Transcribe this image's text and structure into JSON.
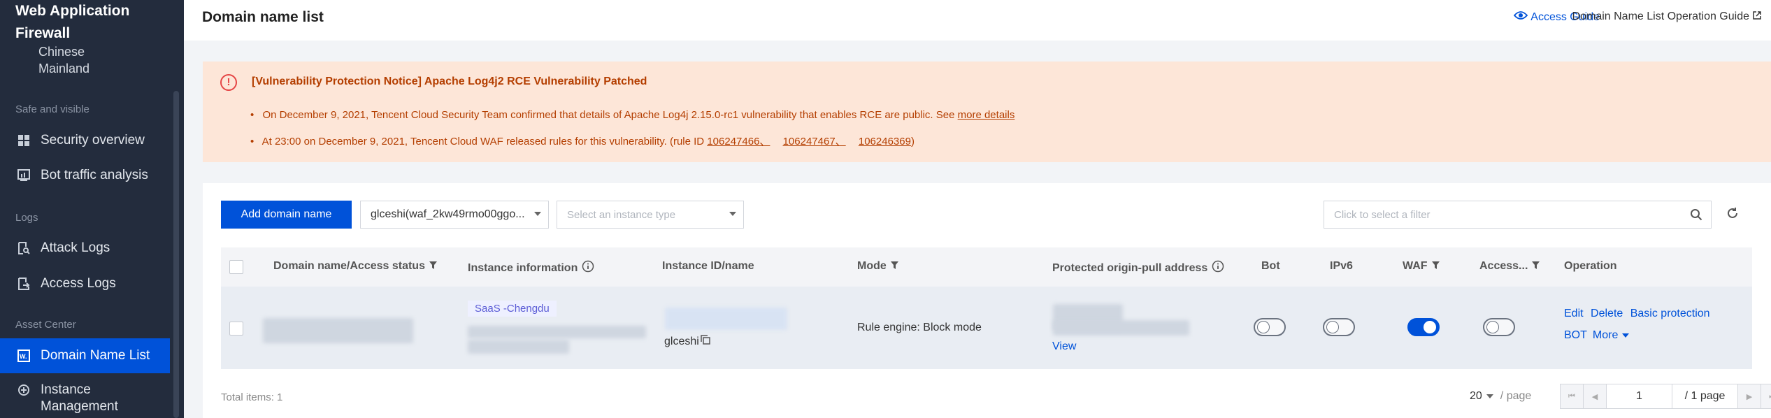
{
  "sidebar": {
    "brand": "Web Application Firewall",
    "region": "Chinese Mainland",
    "groups": {
      "safe": "Safe and visible",
      "logs": "Logs",
      "asset": "Asset Center"
    },
    "items": [
      {
        "label": "Security overview",
        "icon": "grid-icon"
      },
      {
        "label": "Bot traffic analysis",
        "icon": "chart-icon"
      },
      {
        "label": "Attack Logs",
        "icon": "log-search-icon"
      },
      {
        "label": "Access Logs",
        "icon": "log-export-icon"
      },
      {
        "label": "Domain Name List",
        "icon": "waf-domain-icon",
        "active": true
      },
      {
        "label": "Instance Management",
        "icon": "instance-icon"
      }
    ]
  },
  "header": {
    "title": "Domain name list",
    "access_guide": "Access Guide",
    "op_guide": "Domain Name List Operation Guide"
  },
  "notice": {
    "title": "[Vulnerability Protection Notice] Apache Log4j2 RCE Vulnerability Patched",
    "line1_text": "On December 9, 2021, Tencent Cloud Security Team confirmed that details of Apache Log4j 2.15.0-rc1 vulnerability that enables RCE are public. See",
    "line1_link": "more details",
    "line2_text": "At 23:00 on December 9, 2021, Tencent Cloud WAF released rules for this vulnerability. (rule ID",
    "line2_links": [
      "106247466、",
      "106247467、",
      "106246369"
    ],
    "line2_end": ")"
  },
  "toolbar": {
    "add_button": "Add domain name",
    "instance_select": "glceshi(waf_2kw49rmo00ggo...",
    "type_placeholder": "Select an instance type",
    "filter_placeholder": "Click to select a filter"
  },
  "table": {
    "columns": {
      "domain": "Domain name/Access status",
      "instance_info": "Instance information",
      "instance_id": "Instance ID/name",
      "mode": "Mode",
      "origin": "Protected origin-pull address",
      "bot": "Bot",
      "ipv6": "IPv6",
      "waf": "WAF",
      "access": "Access...",
      "operation": "Operation"
    },
    "rows": [
      {
        "tag": "SaaS -Chengdu",
        "instance_name": "glceshi",
        "mode": "Rule engine: Block mode",
        "origin_view": "View",
        "bot": false,
        "ipv6": false,
        "waf": true,
        "access": false,
        "ops": {
          "edit": "Edit",
          "delete": "Delete",
          "basic": "Basic protection",
          "bot": "BOT",
          "more": "More"
        }
      }
    ]
  },
  "footer": {
    "total": "Total items: 1",
    "page_size": "20",
    "per_page": "/ page",
    "current_page": "1",
    "pages": "/ 1 page"
  },
  "colors": {
    "primary": "#0052d9",
    "sidebar_bg": "#232c3d",
    "notice_bg": "#fde6d8",
    "notice_text": "#b43e00"
  }
}
